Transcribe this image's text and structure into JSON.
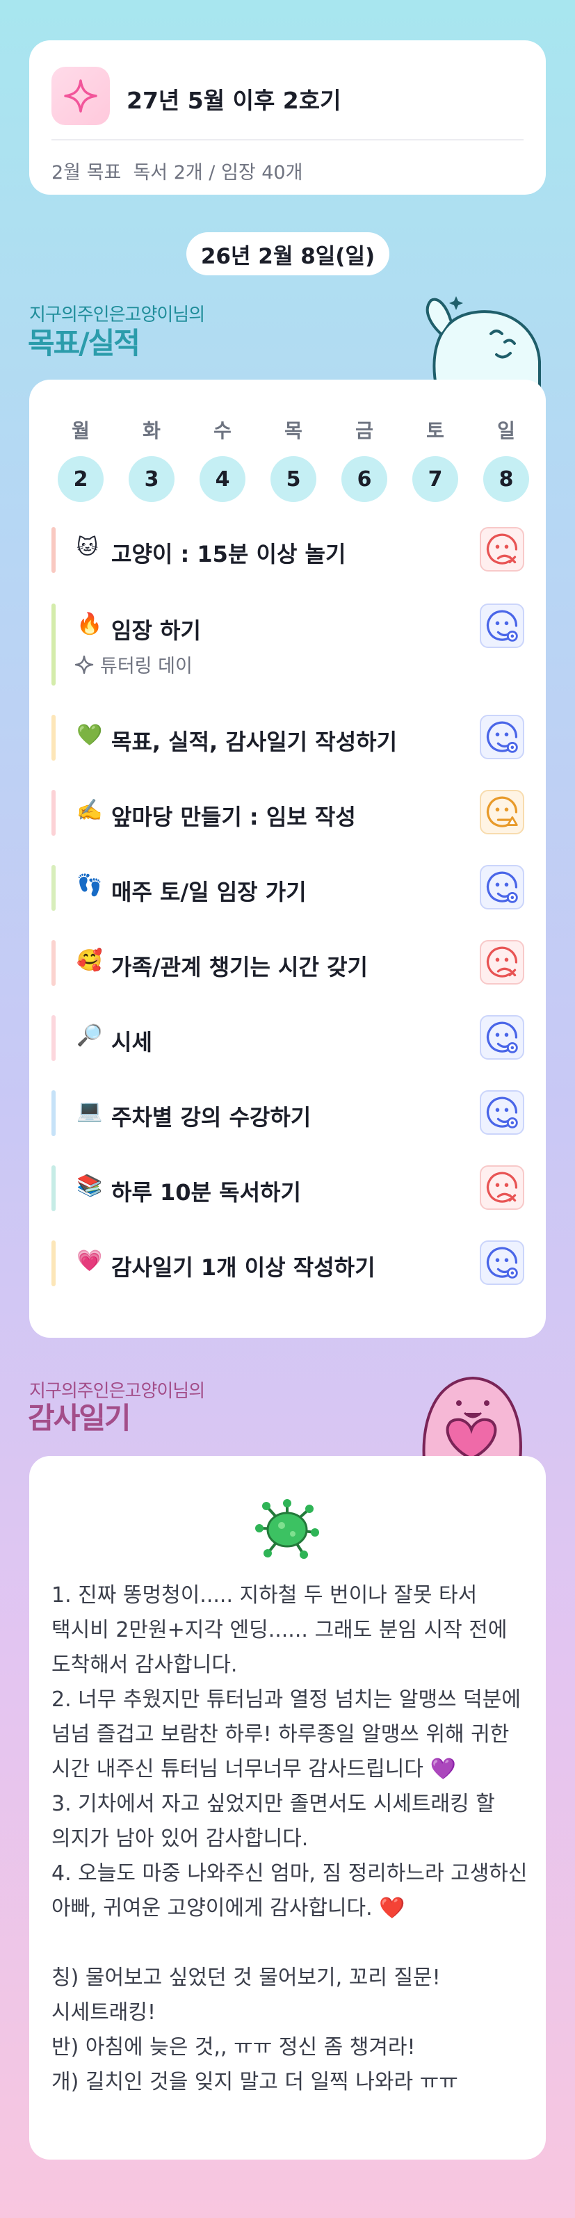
{
  "goal_card": {
    "title": "27년 5월 이후 2호기",
    "subtitle": "2월 목표  독서 2개 / 임장 40개",
    "icon": "sparkle-icon"
  },
  "date_label": "26년 2월 8일(일)",
  "goals_section": {
    "owner": "지구의주인은고양이님의",
    "title": "목표/실적",
    "title_color": "#2b9cab"
  },
  "week": {
    "days": [
      "월",
      "화",
      "수",
      "목",
      "금",
      "토",
      "일"
    ],
    "dates": [
      "2",
      "3",
      "4",
      "5",
      "6",
      "7",
      "8"
    ]
  },
  "tasks": [
    {
      "emoji": "🐱",
      "label": "고양이 : 15분 이상 놀기",
      "bar_color": "#f9c9c1",
      "status": "bad",
      "status_icon": "sad-x-face-icon"
    },
    {
      "emoji": "🔥",
      "label": "임장 하기",
      "sub": "튜터링 데이",
      "bar_color": "#d4ecab",
      "status": "good",
      "status_icon": "smile-check-face-icon"
    },
    {
      "emoji": "💚",
      "label": "목표, 실적, 감사일기 작성하기",
      "bar_color": "#fde6b8",
      "status": "good",
      "status_icon": "smile-check-face-icon"
    },
    {
      "emoji": "✍️",
      "label": "앞마당 만들기 : 임보 작성",
      "bar_color": "#fcd2d6",
      "status": "mid",
      "status_icon": "neutral-triangle-face-icon"
    },
    {
      "emoji": "👣",
      "label": "매주 토/일 임장 가기",
      "bar_color": "#d8eebb",
      "status": "good",
      "status_icon": "smile-check-face-icon"
    },
    {
      "emoji": "🥰",
      "label": "가족/관계 챙기는 시간 갖기",
      "bar_color": "#fbd3cf",
      "status": "bad",
      "status_icon": "sad-x-face-icon"
    },
    {
      "emoji": "🔎",
      "label": "시세",
      "bar_color": "#fcd7dd",
      "status": "good",
      "status_icon": "smile-check-face-icon"
    },
    {
      "emoji": "💻",
      "label": "주차별 강의 수강하기",
      "bar_color": "#c6e2f8",
      "status": "good",
      "status_icon": "smile-check-face-icon"
    },
    {
      "emoji": "📚",
      "label": "하루 10분 독서하기",
      "bar_color": "#c6ece6",
      "status": "bad",
      "status_icon": "sad-x-face-icon"
    },
    {
      "emoji": "💗",
      "label": "감사일기 1개 이상 작성하기",
      "bar_color": "#fce6b8",
      "status": "good",
      "status_icon": "smile-check-face-icon"
    }
  ],
  "diary_section": {
    "owner": "지구의주인은고양이님의",
    "title": "감사일기",
    "title_color": "#a34d89",
    "icon": "germ-icon",
    "text": "1. 진짜 똥멍청이..... 지하철 두 번이나 잘못 타서 택시비 2만원+지각 엔딩...... 그래도 분임 시작 전에 도착해서 감사합니다.\n2. 너무 추웠지만 튜터님과 열정 넘치는 알맹쓰 덕분에 넘넘 즐겁고 보람찬 하루! 하루종일 알맹쓰 위해 귀한 시간 내주신 튜터님 너무너무 감사드립니다 💜\n3. 기차에서 자고 싶었지만 졸면서도 시세트래킹 할 의지가 남아 있어 감사합니다.\n4. 오늘도 마중 나와주신 엄마, 짐 정리하느라 고생하신 아빠, 귀여운 고양이에게 감사합니다. ❤️\n\n칭) 물어보고 싶었던 것 물어보기, 꼬리 질문! 시세트래킹!\n반) 아침에 늦은 것,, ㅠㅠ 정신 좀 챙겨라!\n개) 길치인 것을 잊지 말고 더 일찍 나와라 ㅠㅠ"
  }
}
